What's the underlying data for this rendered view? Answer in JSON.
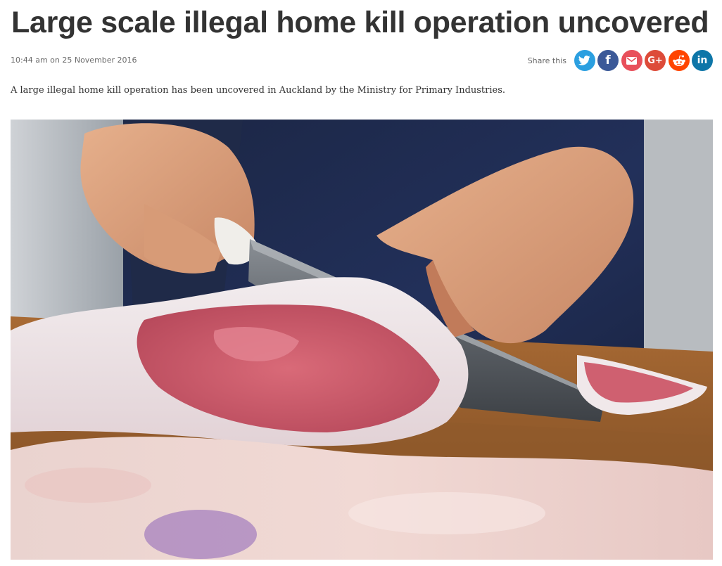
{
  "article": {
    "headline": "Large scale illegal home kill operation uncovered",
    "timestamp": "10:44 am on 25 November 2016",
    "standfirst": "A large illegal home kill operation has been uncovered in Auckland by the Ministry for Primary Industries."
  },
  "share": {
    "label": "Share this",
    "buttons": [
      {
        "name": "twitter",
        "icon": "twitter-bird-icon",
        "color": "#2b9fe0"
      },
      {
        "name": "facebook",
        "icon": "facebook-f-icon",
        "glyph": "f",
        "color": "#3b5998"
      },
      {
        "name": "email",
        "icon": "envelope-icon",
        "color": "#e8505b"
      },
      {
        "name": "google-plus",
        "icon": "google-plus-icon",
        "glyph": "G+",
        "color": "#dd4b39"
      },
      {
        "name": "reddit",
        "icon": "reddit-alien-icon",
        "color": "#ff4500"
      },
      {
        "name": "linkedin",
        "icon": "linkedin-icon",
        "glyph": "in",
        "color": "#0e76a8"
      }
    ]
  },
  "image": {
    "subject": "butcher-cutting-meat-photo"
  }
}
